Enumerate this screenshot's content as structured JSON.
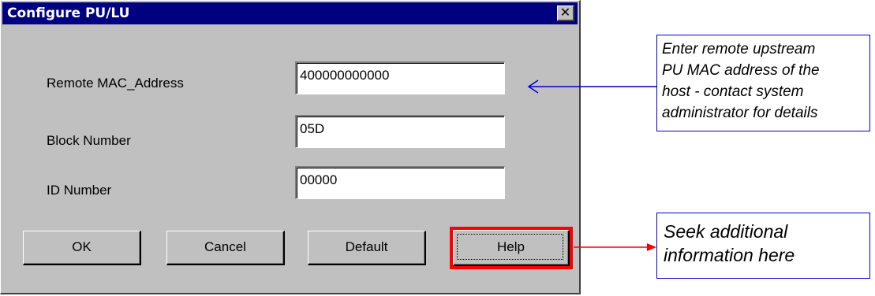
{
  "dialog": {
    "title": "Configure PU/LU",
    "close_glyph": "✕"
  },
  "fields": [
    {
      "label": "Remote MAC_Address",
      "value": "400000000000"
    },
    {
      "label": "Block Number",
      "value": "05D"
    },
    {
      "label": "ID Number",
      "value": "00000"
    }
  ],
  "buttons": {
    "ok": "OK",
    "cancel": "Cancel",
    "default": "Default",
    "help": "Help"
  },
  "annotations": {
    "mac_callout": [
      "Enter remote upstream",
      "PU MAC address of the",
      "host - contact system",
      "administrator for details"
    ],
    "help_callout": [
      "Seek additional",
      "information here"
    ],
    "mac_arrow_color": "#0000cc",
    "help_arrow_color": "#ff0000"
  }
}
